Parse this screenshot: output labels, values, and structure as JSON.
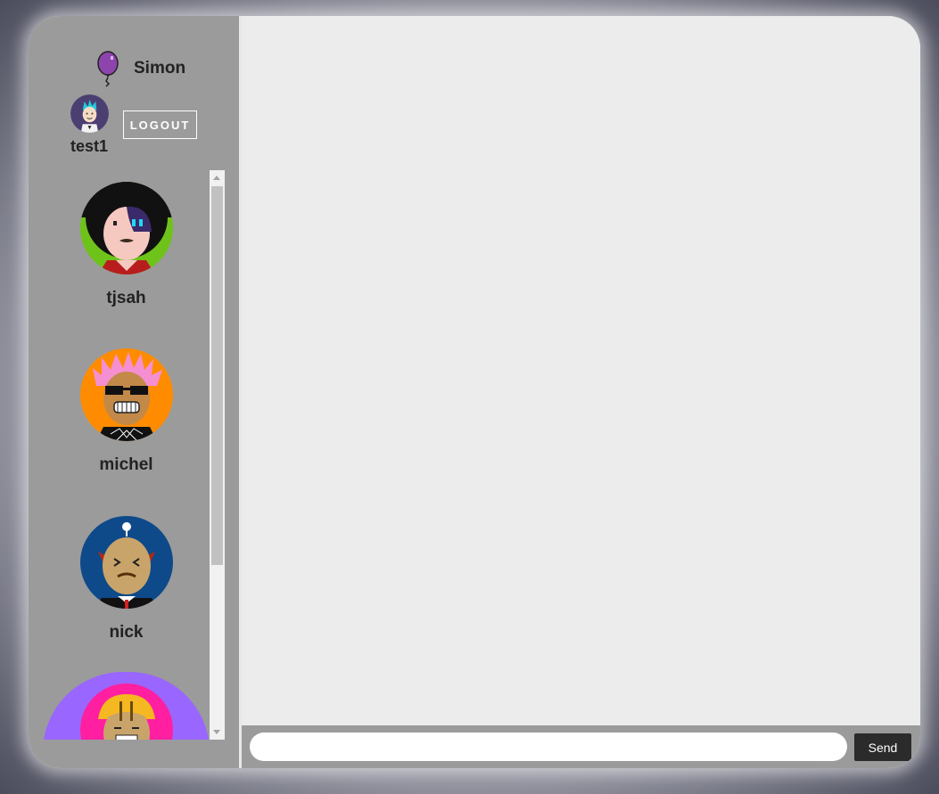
{
  "brand": {
    "name": "Simon",
    "icon": "balloon-icon"
  },
  "current_user": {
    "name": "test1",
    "avatar": "avatar-icon"
  },
  "logout_label": "LOGOUT",
  "users": [
    {
      "name": "tjsah",
      "avatar": "avatar-icon"
    },
    {
      "name": "michel",
      "avatar": "avatar-icon"
    },
    {
      "name": "nick",
      "avatar": "avatar-icon"
    },
    {
      "name": "",
      "avatar": "avatar-icon",
      "selected": true
    }
  ],
  "composer": {
    "placeholder": "",
    "send_label": "Send"
  },
  "colors": {
    "sidebar": "#9b9b9b",
    "chat_bg": "#ececec",
    "selected_user": "#9966ff",
    "send_button": "#2b2b2b"
  }
}
